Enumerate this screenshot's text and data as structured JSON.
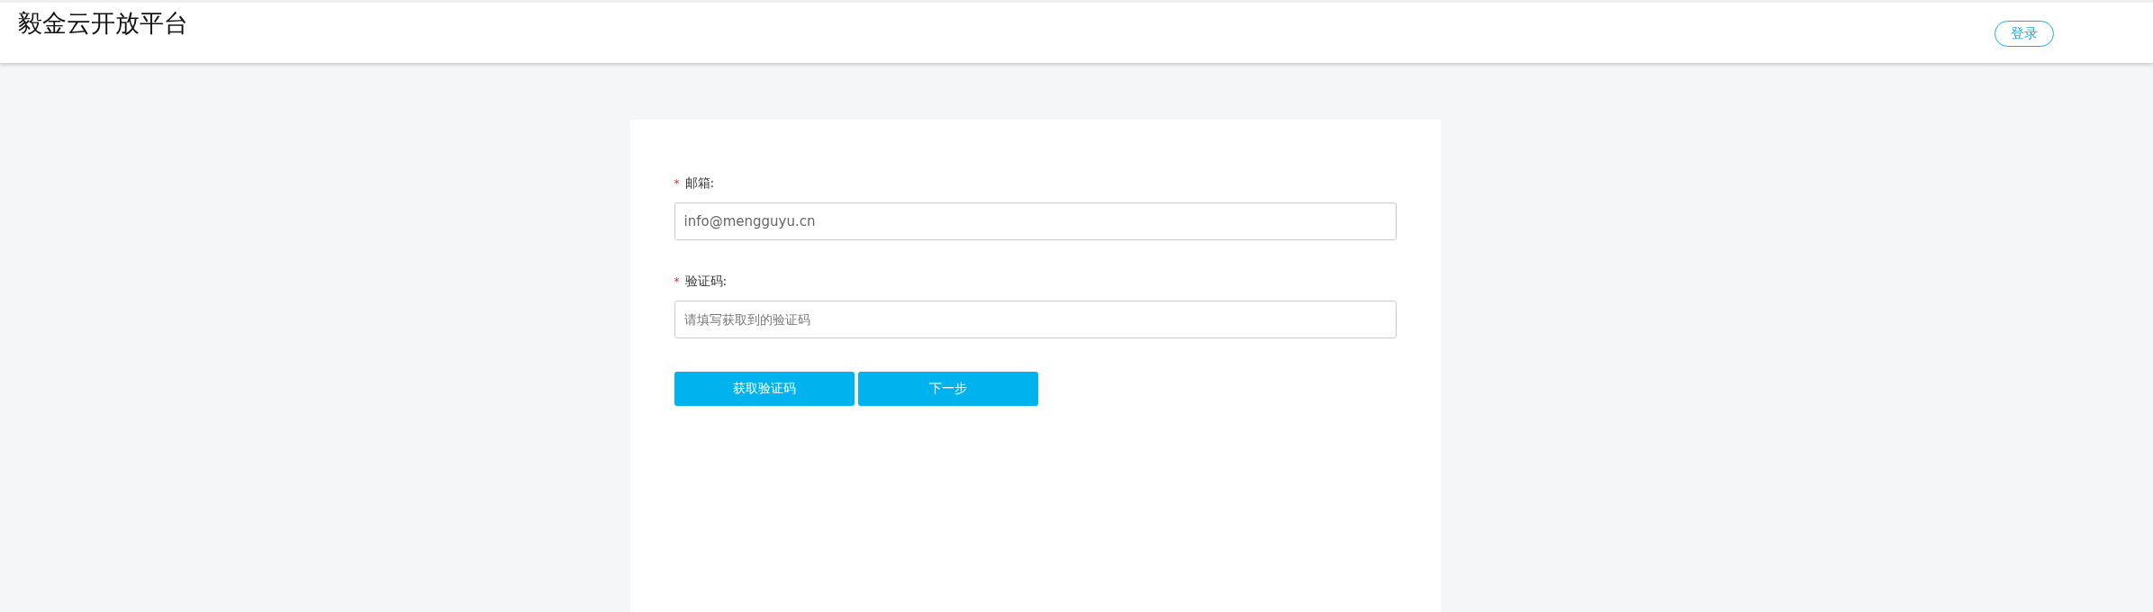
{
  "header": {
    "title": "毅金云开放平台",
    "login_button": "登录"
  },
  "form": {
    "fields": [
      {
        "required_mark": "*",
        "label": "邮箱:",
        "value": "info@mengguyu.cn"
      },
      {
        "required_mark": "*",
        "label": "验证码:",
        "placeholder": "请填写获取到的验证码"
      }
    ],
    "buttons": [
      "获取验证码",
      "下一步"
    ]
  }
}
